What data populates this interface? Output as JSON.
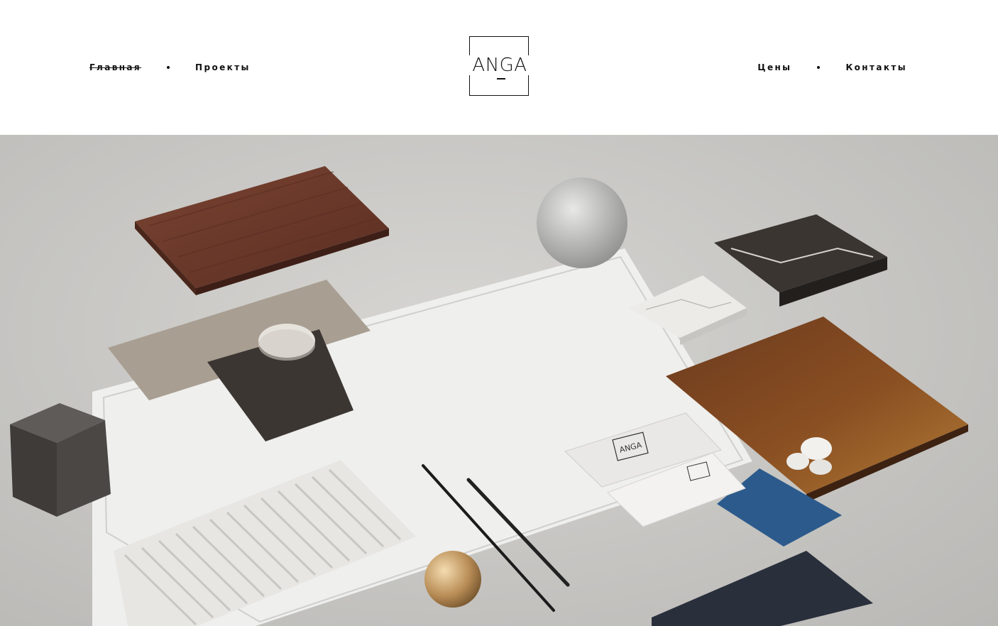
{
  "brand": {
    "logo_text": "ANGA"
  },
  "nav": {
    "left": [
      {
        "label": "Главная",
        "active": true
      },
      {
        "label": "Проекты",
        "active": false
      }
    ],
    "right": [
      {
        "label": "Цены",
        "active": false
      },
      {
        "label": "Контакты",
        "active": false
      }
    ]
  },
  "hero": {
    "card_logo": "ANGA"
  },
  "colors": {
    "text": "#111111",
    "background": "#ffffff",
    "concrete": "#c9c8c5"
  }
}
